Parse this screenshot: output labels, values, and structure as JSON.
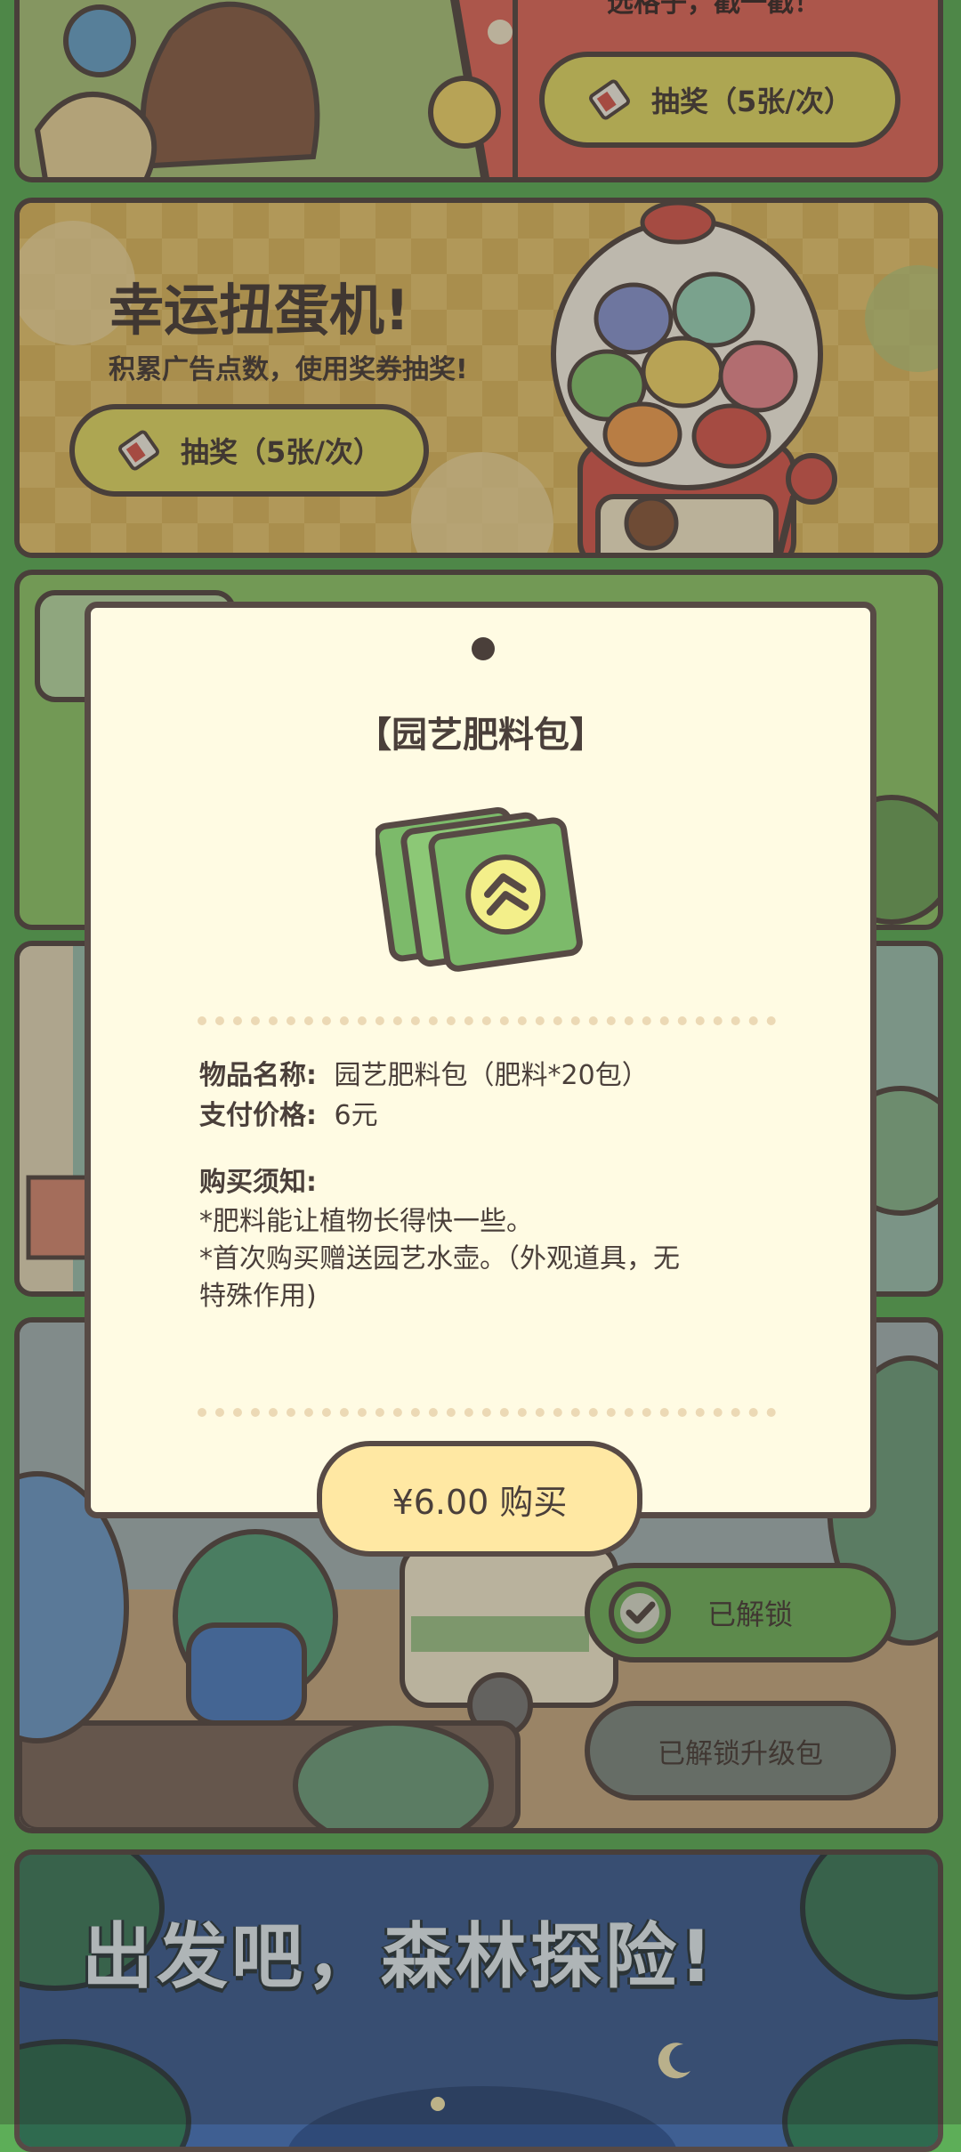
{
  "colors": {
    "page_bg": "#5dae58",
    "outline": "#574a45",
    "card_top_bg": "#e06a5c",
    "card_gacha_bg": "#e6c56f",
    "pill_yellow": "#e1d966",
    "modal_bg": "#fffbe3",
    "buy_button": "#ffe8a3",
    "unlocked_green": "#72b25d",
    "upgrade_gray": "#7f8a82",
    "forest_bg": "#3f5f92"
  },
  "top_card": {
    "subtitle_partial": "选格子，戳一戳！",
    "draw_button_label": "抽奖（5张/次）",
    "ticket_icon": "ticket-icon"
  },
  "gacha_card": {
    "title": "幸运扭蛋机!",
    "subtitle": "积累广告点数，使用奖券抽奖!",
    "draw_button_label": "抽奖（5张/次）",
    "ticket_icon": "ticket-icon",
    "illustration": "gacha-machine-illustration"
  },
  "modal": {
    "title": "【园艺肥料包】",
    "item_icon": "fertilizer-pack-icon",
    "item_name_label": "物品名称:",
    "item_name_value": "园艺肥料包（肥料*20包）",
    "price_label": "支付价格:",
    "price_value": "6元",
    "notice_heading": "购买须知:",
    "notice_line1": "*肥料能让植物长得快一些。",
    "notice_line2": "*首次购买赠送园艺水壶。（外观道具，无",
    "notice_line3": "特殊作用)",
    "buy_button_label": "¥6.00 购买"
  },
  "bus_card": {
    "unlocked_label": "已解锁",
    "check_icon": "check-circle-icon",
    "upgrade_label": "已解锁升级包",
    "illustration": "frogs-and-bus-illustration"
  },
  "forest_card": {
    "title": "出发吧，森林探险!",
    "moon_icon": "crescent-moon-icon"
  }
}
